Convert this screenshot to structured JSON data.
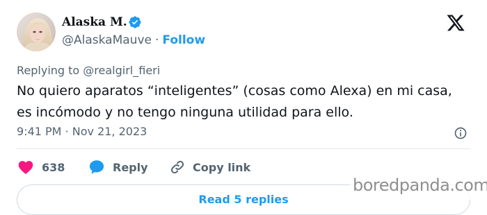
{
  "header": {
    "display_name": "Alaska M.",
    "handle": "@AlaskaMauve",
    "separator": "·",
    "follow_label": "Follow"
  },
  "tweet": {
    "replying_prefix": "Replying to",
    "replying_to": "@realgirl_fieri",
    "text": "No quiero aparatos “inteligentes” (cosas como Alexa) en mi casa,\nes incómodo y no tengo ninguna utilidad para ello.",
    "time": "9:41 PM",
    "time_separator": "·",
    "date": "Nov 21, 2023"
  },
  "actions": {
    "like_count": "638",
    "reply_label": "Reply",
    "copy_link_label": "Copy link"
  },
  "read_replies_label": "Read 5 replies",
  "watermark": "boredpanda.com",
  "colors": {
    "like": "#f91880",
    "accent": "#1d9bf0",
    "secondary_text": "#536471",
    "primary_text": "#0f1419"
  },
  "icons": {
    "verified": "verified-badge-icon",
    "logo": "x-logo-icon",
    "info": "info-icon",
    "like": "heart-icon",
    "reply": "speech-bubble-icon",
    "copy_link": "link-icon"
  }
}
